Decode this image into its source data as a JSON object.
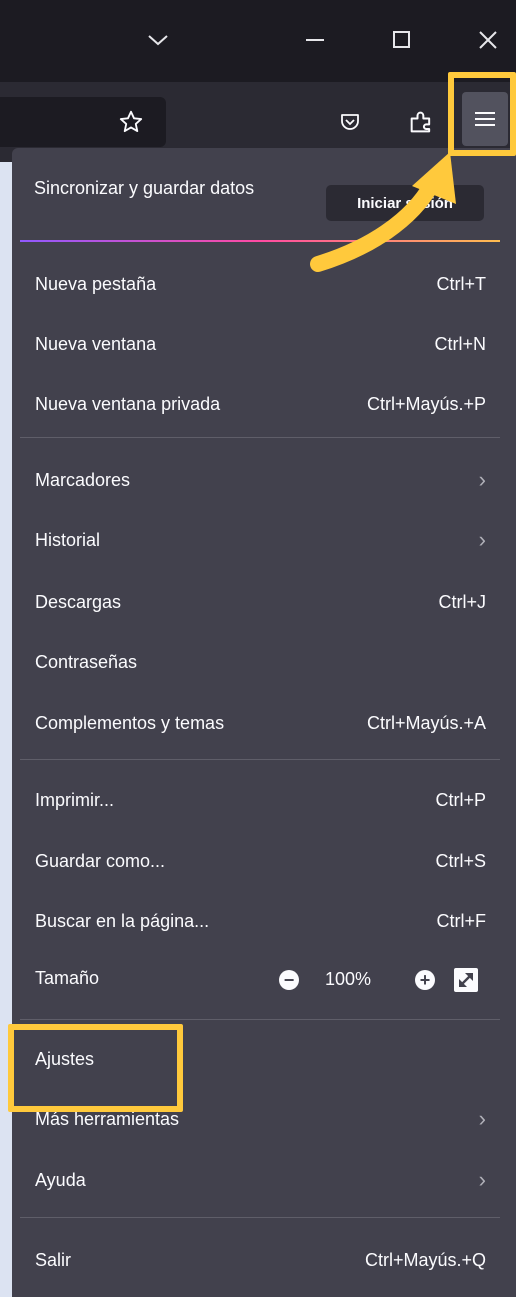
{
  "titlebar": {
    "dropdown_icon": "chevron-down-icon",
    "minimize_icon": "minimize-icon",
    "maximize_icon": "maximize-icon",
    "close_icon": "close-icon"
  },
  "toolbar": {
    "icons": [
      "star-icon",
      "pocket-icon",
      "extensions-icon",
      "hamburger-menu-icon"
    ]
  },
  "menu": {
    "sync_label": "Sincronizar y guardar datos",
    "sync_button": "Iniciar sesión",
    "group1": [
      {
        "label": "Nueva pestaña",
        "shortcut": "Ctrl+T"
      },
      {
        "label": "Nueva ventana",
        "shortcut": "Ctrl+N"
      },
      {
        "label": "Nueva ventana privada",
        "shortcut": "Ctrl+Mayús.+P"
      }
    ],
    "group2": [
      {
        "label": "Marcadores",
        "shortcut": "",
        "submenu": true
      },
      {
        "label": "Historial",
        "shortcut": "",
        "submenu": true
      },
      {
        "label": "Descargas",
        "shortcut": "Ctrl+J"
      },
      {
        "label": "Contraseñas",
        "shortcut": ""
      },
      {
        "label": "Complementos y temas",
        "shortcut": "Ctrl+Mayús.+A"
      }
    ],
    "group3": [
      {
        "label": "Imprimir...",
        "shortcut": "Ctrl+P"
      },
      {
        "label": "Guardar como...",
        "shortcut": "Ctrl+S"
      },
      {
        "label": "Buscar en la página...",
        "shortcut": "Ctrl+F"
      }
    ],
    "zoom": {
      "label": "Tamaño",
      "value": "100%",
      "minus": "−",
      "plus": "+"
    },
    "group4": [
      {
        "label": "Ajustes",
        "shortcut": ""
      },
      {
        "label": "Más herramientas",
        "shortcut": "",
        "submenu": true
      },
      {
        "label": "Ayuda",
        "shortcut": "",
        "submenu": true
      }
    ],
    "group5": [
      {
        "label": "Salir",
        "shortcut": "Ctrl+Mayús.+Q"
      }
    ],
    "chevron": "›"
  },
  "colors": {
    "menu_bg": "#42414d",
    "titlebar_bg": "#1c1b22",
    "toolbar_bg": "#2b2a33",
    "highlight": "#ffc93c",
    "page_bg": "#dce3f2"
  }
}
